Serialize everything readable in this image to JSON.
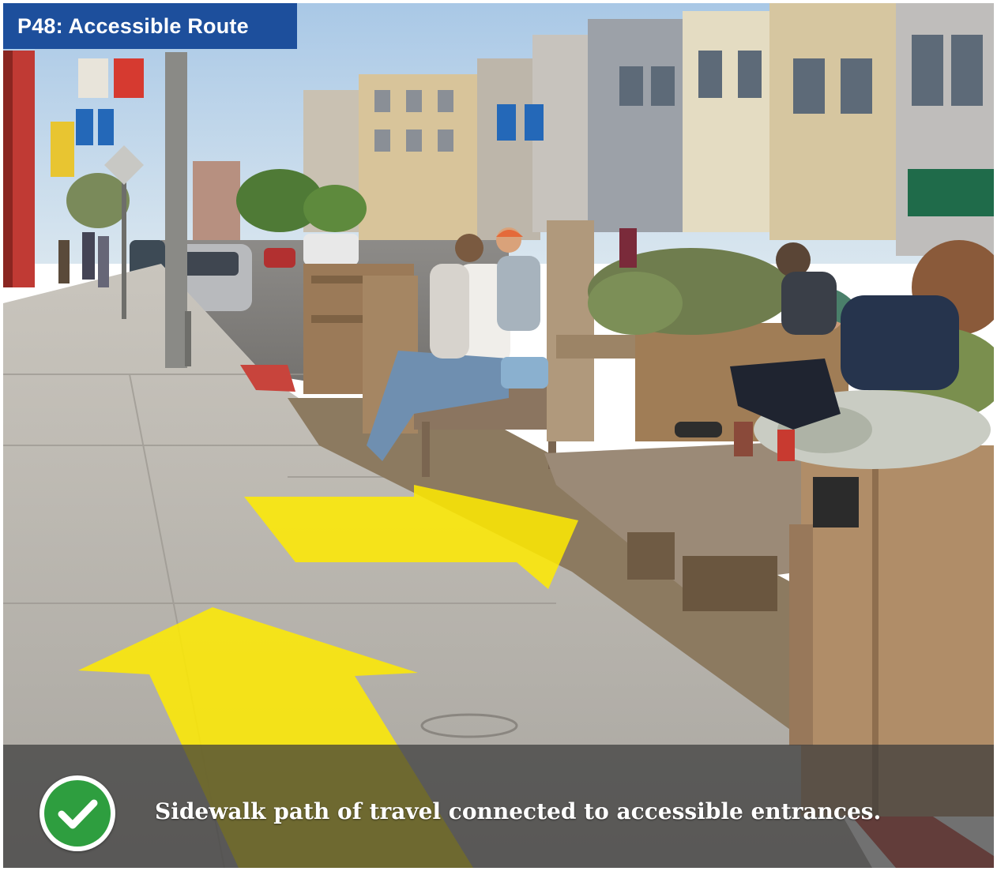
{
  "title": "P48: Accessible Route",
  "caption": "Sidewalk path of travel connected to accessible entrances.",
  "colors": {
    "title_bg": "#1d4f9c",
    "arrow": "#ffeb00",
    "check_green": "#2e9e3f"
  },
  "icons": {
    "check": "check-circle-icon",
    "arrows": "direction-arrow-icon"
  }
}
